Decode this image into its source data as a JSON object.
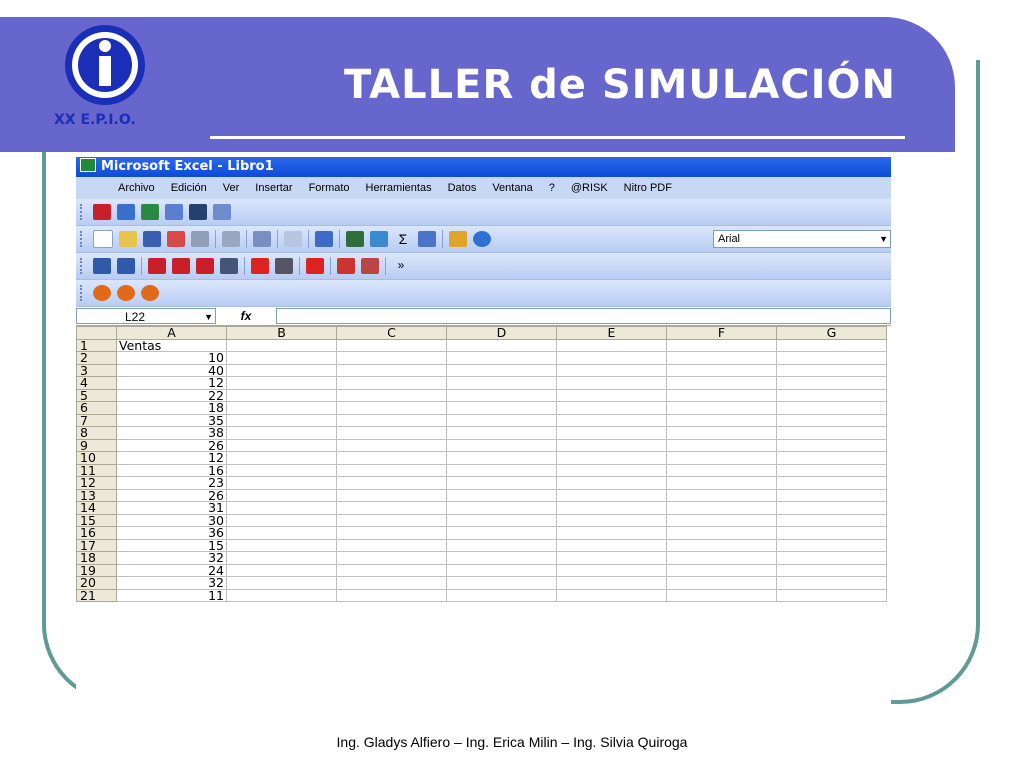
{
  "slide": {
    "title": "TALLER de SIMULACIÓN",
    "logo_text": "XX E.P.I.O.",
    "footer": "Ing. Gladys Alfiero – Ing. Erica Milin – Ing. Silvia Quiroga"
  },
  "excel": {
    "window_title": "Microsoft Excel - Libro1",
    "menu": [
      "Archivo",
      "Edición",
      "Ver",
      "Insertar",
      "Formato",
      "Herramientas",
      "Datos",
      "Ventana",
      "?",
      "@RISK",
      "Nitro PDF"
    ],
    "font_name": "Arial",
    "name_box": "L22",
    "fx_label": "fx",
    "columns": [
      "A",
      "B",
      "C",
      "D",
      "E",
      "F",
      "G"
    ],
    "rows": [
      {
        "n": "1",
        "a": "Ventas"
      },
      {
        "n": "2",
        "a": "10"
      },
      {
        "n": "3",
        "a": "40"
      },
      {
        "n": "4",
        "a": "12"
      },
      {
        "n": "5",
        "a": "22"
      },
      {
        "n": "6",
        "a": "18"
      },
      {
        "n": "7",
        "a": "35"
      },
      {
        "n": "8",
        "a": "38"
      },
      {
        "n": "9",
        "a": "26"
      },
      {
        "n": "10",
        "a": "12"
      },
      {
        "n": "11",
        "a": "16"
      },
      {
        "n": "12",
        "a": "23"
      },
      {
        "n": "13",
        "a": "26"
      },
      {
        "n": "14",
        "a": "31"
      },
      {
        "n": "15",
        "a": "30"
      },
      {
        "n": "16",
        "a": "36"
      },
      {
        "n": "17",
        "a": "15"
      },
      {
        "n": "18",
        "a": "32"
      },
      {
        "n": "19",
        "a": "24"
      },
      {
        "n": "20",
        "a": "32"
      },
      {
        "n": "21",
        "a": "11"
      }
    ]
  },
  "colors": {
    "header_band": "#6666cc",
    "frame": "#5f9a96",
    "logo_blue": "#1a2eb8"
  }
}
